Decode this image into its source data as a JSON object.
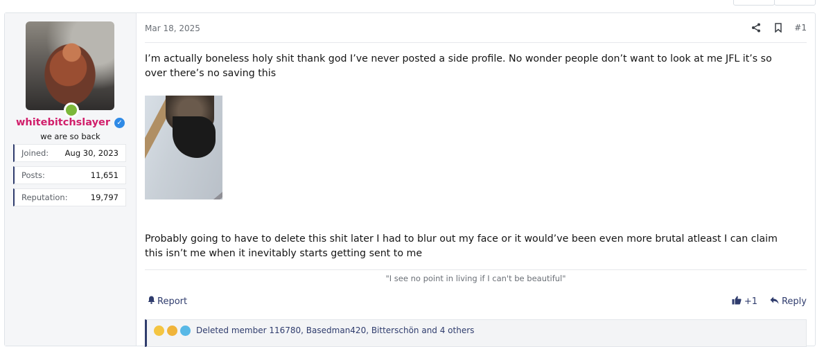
{
  "user": {
    "username": "whitebitchslayer",
    "title": "we are so back",
    "stats": [
      {
        "label": "Joined:",
        "value": "Aug 30, 2023"
      },
      {
        "label": "Posts:",
        "value": "11,651"
      },
      {
        "label": "Reputation:",
        "value": "19,797"
      }
    ],
    "verified_icon": "verified-check-icon",
    "online_color": "#7cb83a"
  },
  "post": {
    "date": "Mar 18, 2025",
    "number": "#1",
    "paragraph1": "I’m actually boneless holy shit thank god I’ve never posted a side profile. No wonder people don’t want to look at me JFL it’s so over there’s no saving this",
    "paragraph2": "Probably going to have to delete this shit later I had to blur out my face or it would’ve been even more brutal atleast I can claim this isn’t me when it inevitably starts getting sent to me",
    "signature": "\"I see no point in living if I can't be beautiful\""
  },
  "actions": {
    "report": "Report",
    "like_count": "+1",
    "reply": "Reply"
  },
  "reactions": {
    "text": "Deleted member 116780, Basedman420, Bitterschön and 4 others"
  },
  "colors": {
    "username": "#d11f6b",
    "accent": "#2f3c6d"
  }
}
